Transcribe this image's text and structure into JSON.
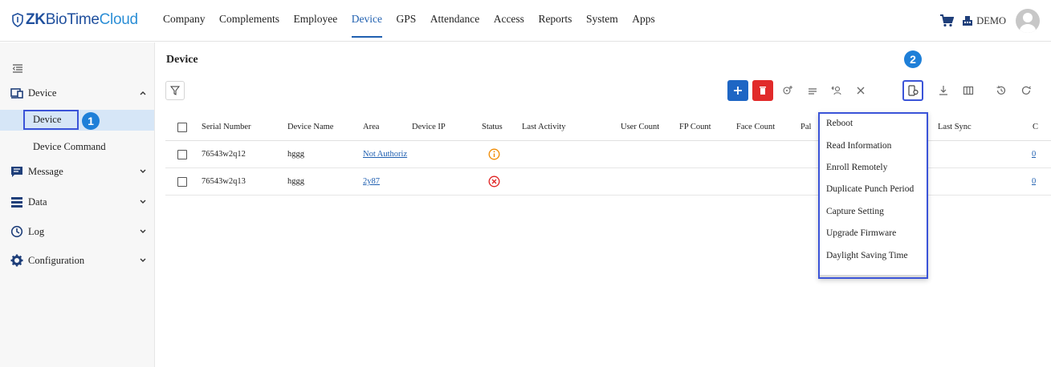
{
  "app": {
    "logo_zk": "ZK",
    "logo_bio": "BioTime",
    "logo_cloud": "Cloud",
    "user": "DEMO"
  },
  "nav": [
    "Company",
    "Complements",
    "Employee",
    "Device",
    "GPS",
    "Attendance",
    "Access",
    "Reports",
    "System",
    "Apps"
  ],
  "nav_active": "Device",
  "sidebar": {
    "groups": [
      {
        "label": "Device",
        "icon": "device-icon",
        "expanded": true
      },
      {
        "label": "Message",
        "icon": "message-icon"
      },
      {
        "label": "Data",
        "icon": "data-icon"
      },
      {
        "label": "Log",
        "icon": "clock-icon"
      },
      {
        "label": "Configuration",
        "icon": "gear-icon"
      }
    ],
    "sub": [
      "Device",
      "Device Command"
    ]
  },
  "page": {
    "title": "Device"
  },
  "annotations": {
    "badge1": "1",
    "badge2": "2"
  },
  "table": {
    "headers": [
      "Serial Number",
      "Device Name",
      "Area",
      "Device IP",
      "Status",
      "Last Activity",
      "User Count",
      "FP Count",
      "Face Count",
      "Pal",
      "Last Sync",
      "C"
    ],
    "rows": [
      {
        "serial": "76543w2q12",
        "name": "hggg",
        "area": "Not Authoriz",
        "status": "warning",
        "extra": "0"
      },
      {
        "serial": "76543w2q13",
        "name": "hggg",
        "area": "2y87",
        "status": "error",
        "extra": "0"
      }
    ]
  },
  "menu": {
    "items": [
      "Reboot",
      "Read Information",
      "Enroll Remotely",
      "Duplicate Punch Period",
      "Capture Setting",
      "Upgrade Firmware",
      "Daylight Saving Time"
    ]
  },
  "colors": {
    "accent": "#2060b0",
    "highlight": "#3b54d8",
    "badge": "#1e7fd8",
    "add_button": "#1e66c4",
    "delete_button": "#e12a2a",
    "status_warning": "#f08a00",
    "status_error": "#e02020"
  }
}
